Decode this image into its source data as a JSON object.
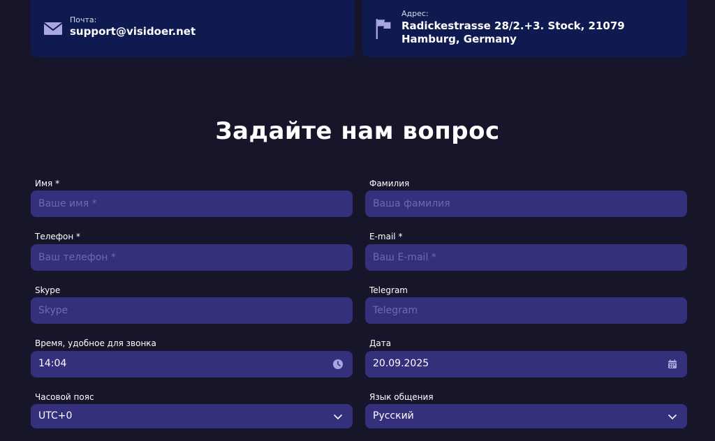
{
  "contacts": {
    "email": {
      "label": "Почта:",
      "value": "support@visidoer.net",
      "icon": "mail-icon"
    },
    "address": {
      "label": "Адрес:",
      "value": "Radickestrasse 28/2.+3. Stock, 21079 Hamburg, Germany",
      "icon": "flag-icon"
    }
  },
  "form": {
    "title": "Задайте нам вопрос",
    "first_name": {
      "label": "Имя *",
      "placeholder": "Ваше имя *"
    },
    "last_name": {
      "label": "Фамилия",
      "placeholder": "Ваша фамилия"
    },
    "phone": {
      "label": "Телефон *",
      "placeholder": "Ваш телефон *"
    },
    "email": {
      "label": "E-mail *",
      "placeholder": "Ваш E-mail *"
    },
    "skype": {
      "label": "Skype",
      "placeholder": "Skype"
    },
    "telegram": {
      "label": "Telegram",
      "placeholder": "Telegram"
    },
    "call_time": {
      "label": "Время, удобное для звонка",
      "value": "14:04",
      "icon": "clock-icon"
    },
    "date": {
      "label": "Дата",
      "value": "20.09.2025",
      "icon": "calendar-icon"
    },
    "timezone": {
      "label": "Часовой пояс",
      "value": "UTC+0",
      "icon": "chevron-down-icon"
    },
    "language": {
      "label": "Язык общения",
      "value": "Русский",
      "icon": "chevron-down-icon"
    }
  },
  "colors": {
    "background": "#16152a",
    "card": "#0e1a50",
    "field": "#34307b",
    "placeholder": "#6d69b2",
    "icon": "#a9a6e0"
  }
}
